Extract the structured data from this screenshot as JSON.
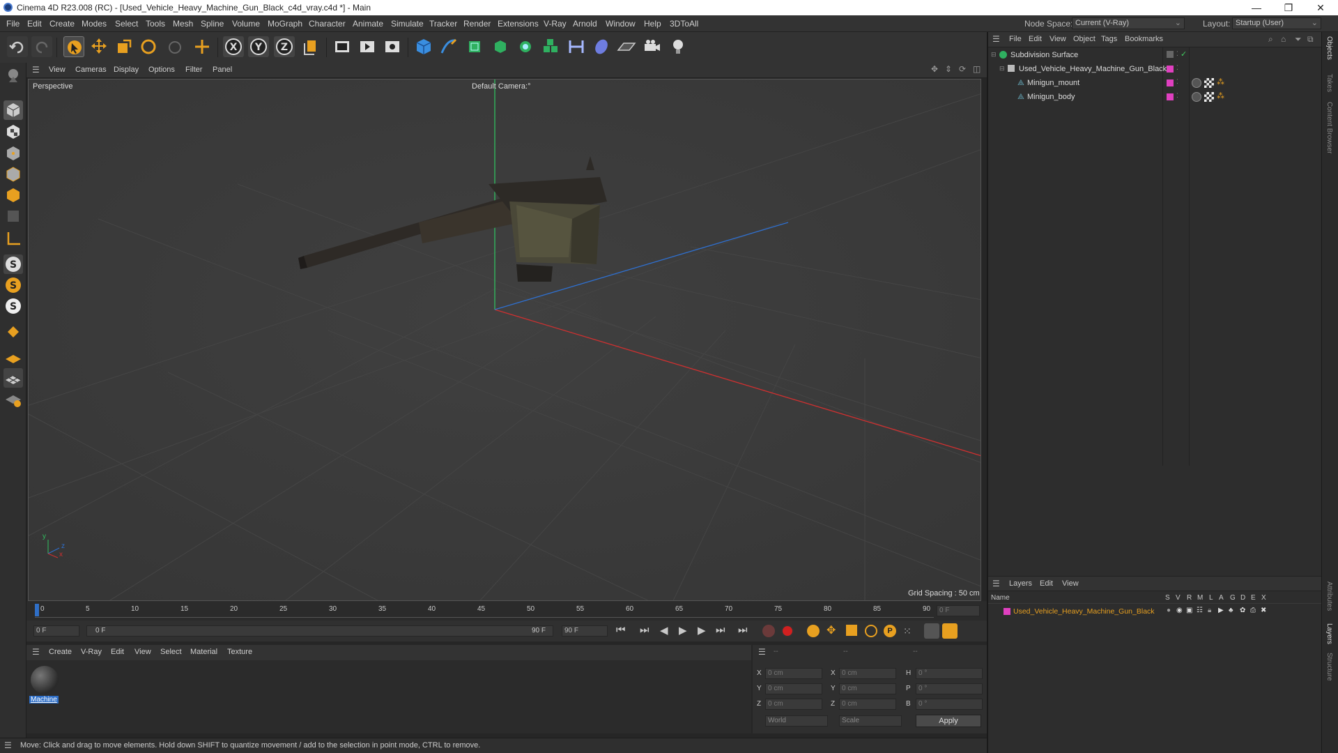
{
  "window": {
    "title": "Cinema 4D R23.008 (RC) - [Used_Vehicle_Heavy_Machine_Gun_Black_c4d_vray.c4d *] - Main",
    "minimize": "—",
    "maximize": "❐",
    "close": "✕"
  },
  "menubar": {
    "items": [
      "File",
      "Edit",
      "Create",
      "Modes",
      "Select",
      "Tools",
      "Mesh",
      "Spline",
      "Volume",
      "MoGraph",
      "Character",
      "Animate",
      "Simulate",
      "Tracker",
      "Render",
      "Extensions",
      "V-Ray",
      "Arnold",
      "Window",
      "Help",
      "3DToAll"
    ],
    "node_space_label": "Node Space:",
    "node_space_value": "Current (V-Ray)",
    "layout_label": "Layout:",
    "layout_value": "Startup (User)"
  },
  "viewport": {
    "menu": [
      "View",
      "Cameras",
      "Display",
      "Options",
      "Filter",
      "Panel"
    ],
    "label": "Perspective",
    "camera": "Default Camera:°",
    "grid_spacing": "Grid Spacing : 50 cm",
    "axis_y": "y",
    "axis_z": "z",
    "axis_x": "x"
  },
  "timeline": {
    "ticks": [
      "0",
      "5",
      "10",
      "15",
      "20",
      "25",
      "30",
      "35",
      "40",
      "45",
      "50",
      "55",
      "60",
      "65",
      "70",
      "75",
      "80",
      "85",
      "90"
    ],
    "current_frame": "0 F"
  },
  "transport": {
    "start": "0 F",
    "range_start": "0 F",
    "range_end": "90 F",
    "end": "90 F"
  },
  "materials": {
    "menu": [
      "Create",
      "V-Ray",
      "Edit",
      "View",
      "Select",
      "Material",
      "Texture"
    ],
    "items": [
      {
        "name": "Machine"
      }
    ]
  },
  "coords": {
    "headers": [
      "--",
      "--",
      "--"
    ],
    "pos": [
      {
        "axis": "X",
        "value": "0 cm"
      },
      {
        "axis": "Y",
        "value": "0 cm"
      },
      {
        "axis": "Z",
        "value": "0 cm"
      }
    ],
    "size": [
      {
        "axis": "X",
        "value": "0 cm"
      },
      {
        "axis": "Y",
        "value": "0 cm"
      },
      {
        "axis": "Z",
        "value": "0 cm"
      }
    ],
    "rot": [
      {
        "axis": "H",
        "value": "0 °"
      },
      {
        "axis": "P",
        "value": "0 °"
      },
      {
        "axis": "B",
        "value": "0 °"
      }
    ],
    "world": "World",
    "scale": "Scale",
    "apply": "Apply"
  },
  "status": {
    "text": "Move: Click and drag to move elements. Hold down SHIFT to quantize movement / add to the selection in point mode, CTRL to remove."
  },
  "objects": {
    "menu": [
      "File",
      "Edit",
      "View",
      "Object",
      "Tags",
      "Bookmarks"
    ],
    "rows": [
      {
        "name": "Subdivision Surface"
      },
      {
        "name": "Used_Vehicle_Heavy_Machine_Gun_Black"
      },
      {
        "name": "Minigun_mount"
      },
      {
        "name": "Minigun_body"
      }
    ]
  },
  "layers": {
    "menu": [
      "Layers",
      "Edit",
      "View"
    ],
    "name_header": "Name",
    "cols": [
      "S",
      "V",
      "R",
      "M",
      "L",
      "A",
      "G",
      "D",
      "E",
      "X"
    ],
    "rows": [
      {
        "name": "Used_Vehicle_Heavy_Machine_Gun_Black"
      }
    ]
  },
  "side_tabs": [
    "Objects",
    "Takes",
    "Content Browser",
    "Attributes",
    "Layers",
    "Structure"
  ],
  "colors": {
    "accent": "#2f6fc7",
    "layer_color": "#e040c0",
    "x_axis": "#d03030",
    "y_axis": "#30c060",
    "z_axis": "#2f70d0"
  }
}
